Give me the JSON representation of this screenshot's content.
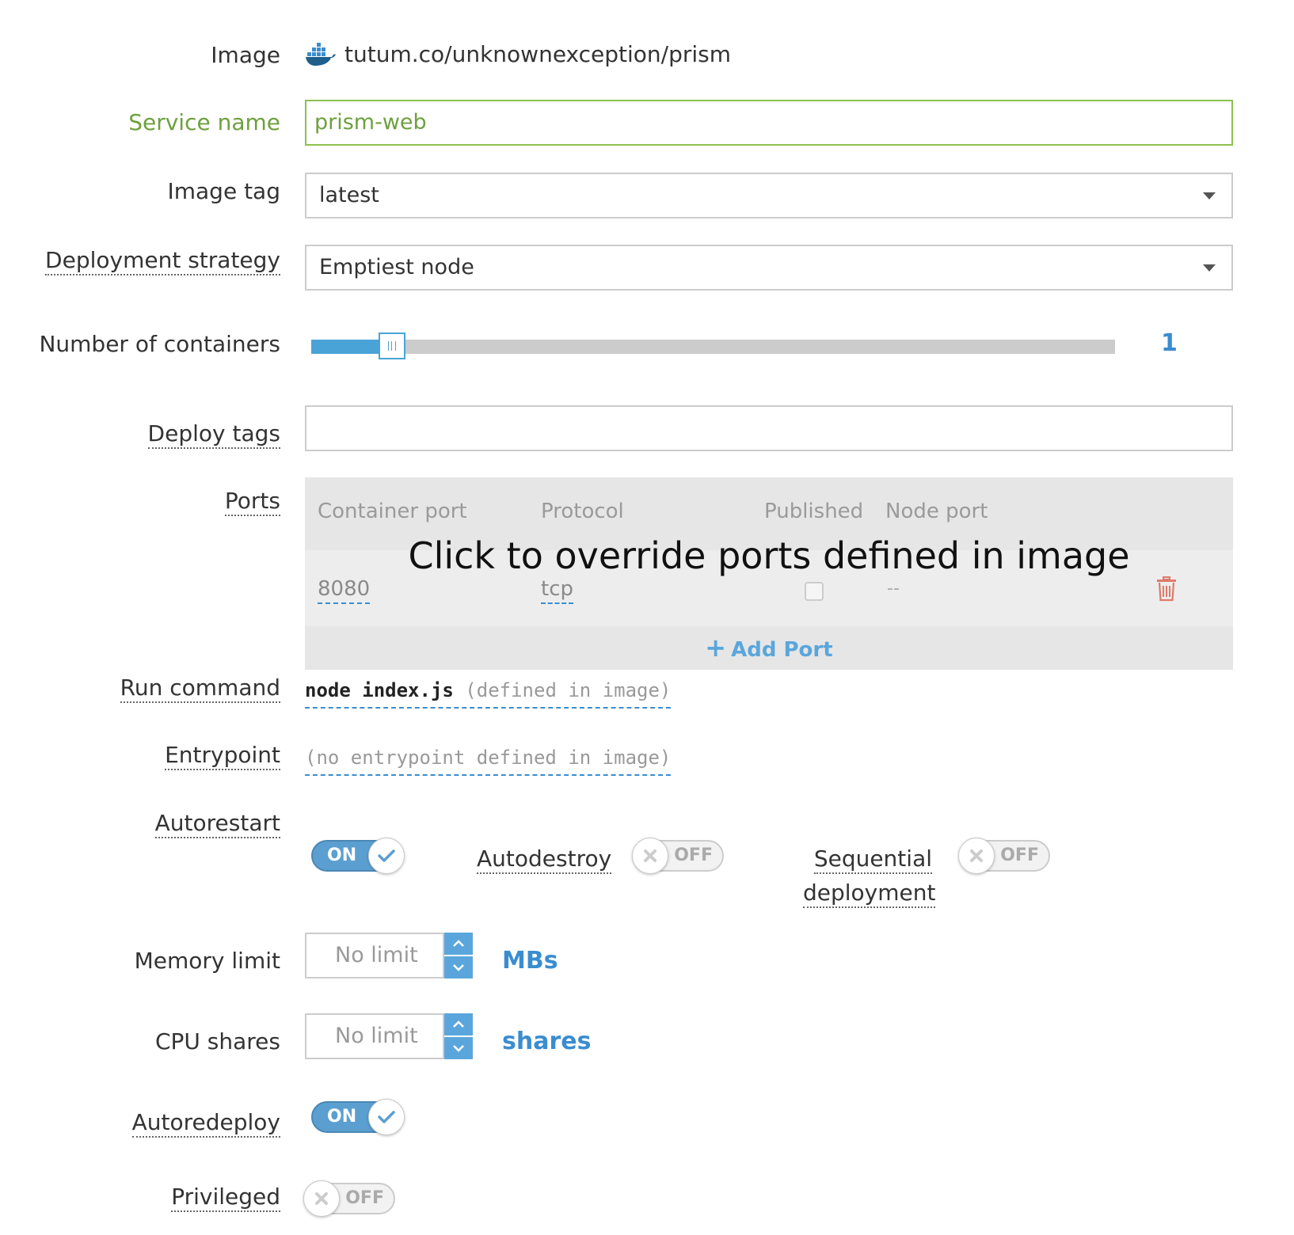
{
  "image": {
    "label": "Image",
    "value": "tutum.co/unknownexception/prism",
    "icon": "docker-whale-icon"
  },
  "service_name": {
    "label": "Service name",
    "value": "prism-web"
  },
  "image_tag": {
    "label": "Image tag",
    "value": "latest"
  },
  "deployment_strategy": {
    "label": "Deployment strategy",
    "value": "Emptiest node"
  },
  "containers": {
    "label": "Number of containers",
    "value": "1",
    "slider_fraction": 0.1
  },
  "deploy_tags": {
    "label": "Deploy tags",
    "value": ""
  },
  "ports": {
    "label": "Ports",
    "columns": [
      "Container port",
      "Protocol",
      "Published",
      "Node port"
    ],
    "rows": [
      {
        "container_port": "8080",
        "protocol": "tcp",
        "published": false,
        "node_port": "--"
      }
    ],
    "overlay": "Click to override ports defined in image",
    "add_label": "Add Port"
  },
  "run_command": {
    "label": "Run command",
    "command": "node index.js",
    "note": "(defined in image)"
  },
  "entrypoint": {
    "label": "Entrypoint",
    "note": "(no entrypoint defined in image)"
  },
  "autorestart": {
    "label": "Autorestart",
    "state": "ON"
  },
  "autodestroy": {
    "label": "Autodestroy",
    "state": "OFF"
  },
  "sequential": {
    "label_line1": "Sequential",
    "label_line2": "deployment",
    "state": "OFF"
  },
  "memory_limit": {
    "label": "Memory limit",
    "placeholder": "No limit",
    "unit": "MBs"
  },
  "cpu_shares": {
    "label": "CPU shares",
    "placeholder": "No limit",
    "unit": "shares"
  },
  "autoredeploy": {
    "label": "Autoredeploy",
    "state": "ON"
  },
  "privileged": {
    "label": "Privileged",
    "state": "OFF"
  },
  "colors": {
    "accent": "#3a8dd0",
    "valid": "#6ea03e",
    "toggle_on": "#5b9fd0",
    "delete": "#e07a6a"
  }
}
